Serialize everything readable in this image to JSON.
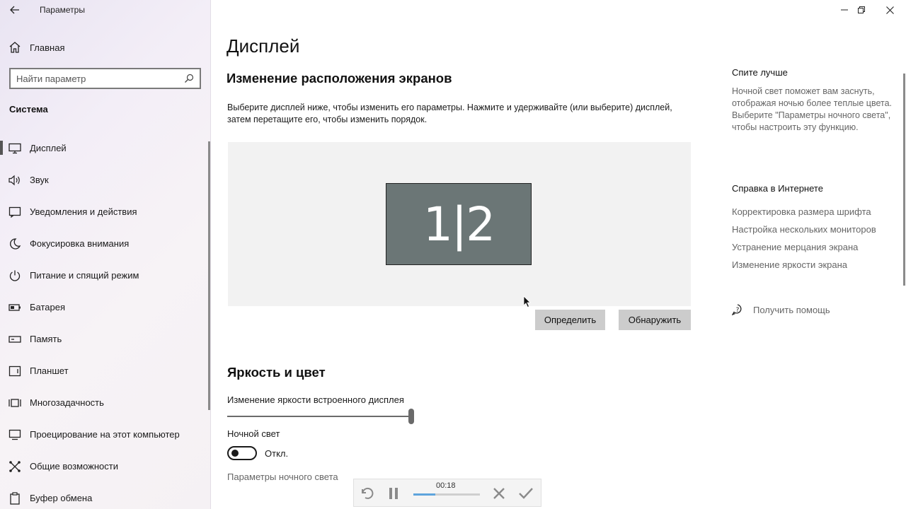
{
  "window": {
    "title": "Параметры"
  },
  "sidebar": {
    "home_label": "Главная",
    "search_placeholder": "Найти параметр",
    "section_heading": "Система",
    "items": [
      {
        "label": "Дисплей",
        "icon": "monitor-icon",
        "active": true
      },
      {
        "label": "Звук",
        "icon": "speaker-icon"
      },
      {
        "label": "Уведомления и действия",
        "icon": "notification-icon"
      },
      {
        "label": "Фокусировка внимания",
        "icon": "moon-icon"
      },
      {
        "label": "Питание и спящий режим",
        "icon": "power-icon"
      },
      {
        "label": "Батарея",
        "icon": "battery-icon"
      },
      {
        "label": "Память",
        "icon": "storage-icon"
      },
      {
        "label": "Планшет",
        "icon": "tablet-icon"
      },
      {
        "label": "Многозадачность",
        "icon": "multitasking-icon"
      },
      {
        "label": "Проецирование на этот компьютер",
        "icon": "projecting-icon"
      },
      {
        "label": "Общие возможности",
        "icon": "shared-experiences-icon"
      },
      {
        "label": "Буфер обмена",
        "icon": "clipboard-icon"
      }
    ]
  },
  "main": {
    "page_title": "Дисплей",
    "arrange_title": "Изменение расположения экранов",
    "arrange_desc": "Выберите дисплей ниже, чтобы изменить его параметры. Нажмите и удерживайте (или выберите) дисплей, затем перетащите его, чтобы изменить порядок.",
    "monitor_label": "1|2",
    "identify_button": "Определить",
    "detect_button": "Обнаружить",
    "brightness_title": "Яркость и цвет",
    "brightness_label": "Изменение яркости встроенного дисплея",
    "brightness_value": 1.0,
    "night_light_label": "Ночной свет",
    "night_light_state": "Откл.",
    "night_light_settings_link": "Параметры ночного света"
  },
  "right_panel": {
    "sleep_heading": "Спите лучше",
    "sleep_text": "Ночной свет поможет вам заснуть, отображая ночью более теплые цвета. Выберите \"Параметры ночного света\", чтобы настроить эту функцию.",
    "web_help_heading": "Справка в Интернете",
    "links": [
      "Корректировка размера шрифта",
      "Настройка нескольких мониторов",
      "Устранение мерцания экрана",
      "Изменение яркости экрана"
    ],
    "get_help": "Получить помощь"
  },
  "recorder": {
    "time": "00:18",
    "progress": 0.33,
    "accent_color": "#5ea4dc"
  }
}
